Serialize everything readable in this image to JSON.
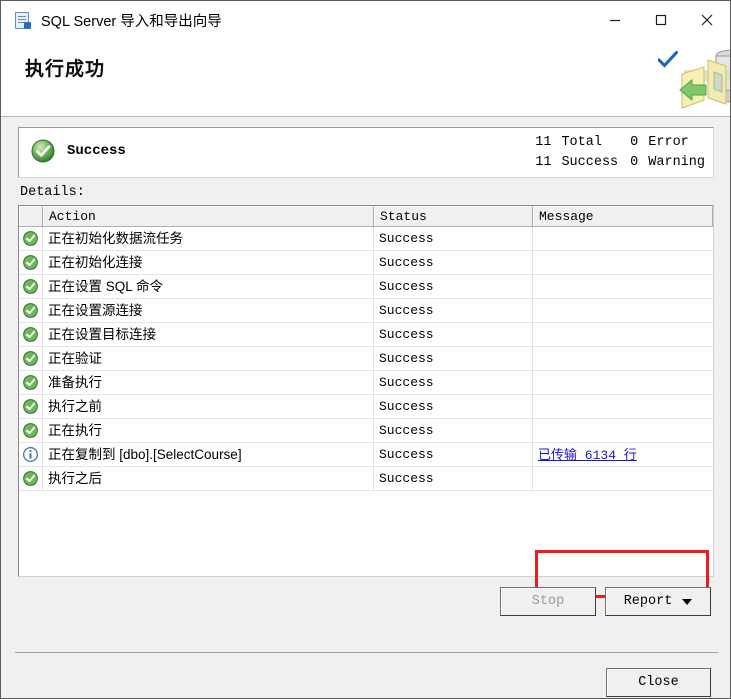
{
  "window": {
    "title": "SQL Server 导入和导出向导",
    "app_icon": "sql-server-wizard-icon",
    "caption": {
      "minimize": "minimize-icon",
      "maximize": "maximize-icon",
      "close": "close-icon"
    }
  },
  "header": {
    "title": "执行成功",
    "check_icon": "blue-checkmark-icon",
    "art_icon": "import-export-wizard-graphic"
  },
  "status_panel": {
    "icon": "green-success-circle-icon",
    "label": "Success",
    "counts": [
      {
        "num": "11",
        "label": "Total",
        "num2": "0",
        "label2": "Error"
      },
      {
        "num": "11",
        "label": "Success",
        "num2": "0",
        "label2": "Warning"
      }
    ]
  },
  "details": {
    "label": "Details:",
    "columns": [
      "",
      "Action",
      "Status",
      "Message"
    ],
    "rows": [
      {
        "icon": "success",
        "action": "正在初始化数据流任务",
        "status": "Success",
        "message": ""
      },
      {
        "icon": "success",
        "action": "正在初始化连接",
        "status": "Success",
        "message": ""
      },
      {
        "icon": "success",
        "action": "正在设置 SQL 命令",
        "status": "Success",
        "message": ""
      },
      {
        "icon": "success",
        "action": "正在设置源连接",
        "status": "Success",
        "message": ""
      },
      {
        "icon": "success",
        "action": "正在设置目标连接",
        "status": "Success",
        "message": ""
      },
      {
        "icon": "success",
        "action": "正在验证",
        "status": "Success",
        "message": ""
      },
      {
        "icon": "success",
        "action": "准备执行",
        "status": "Success",
        "message": ""
      },
      {
        "icon": "success",
        "action": "执行之前",
        "status": "Success",
        "message": ""
      },
      {
        "icon": "success",
        "action": "正在执行",
        "status": "Success",
        "message": ""
      },
      {
        "icon": "info",
        "action": "正在复制到 [dbo].[SelectCourse]",
        "status": "Success",
        "message": "已传输 6134 行",
        "message_is_link": true
      },
      {
        "icon": "success",
        "action": "执行之后",
        "status": "Success",
        "message": ""
      }
    ]
  },
  "buttons": {
    "stop": "Stop",
    "report": "Report",
    "close": "Close"
  },
  "colors": {
    "link": "#1818d0",
    "highlight_box": "#ee1c1c",
    "success_green": "#3f9a3f",
    "info_blue": "#3b6fc0",
    "header_check_blue": "#1565c0"
  }
}
